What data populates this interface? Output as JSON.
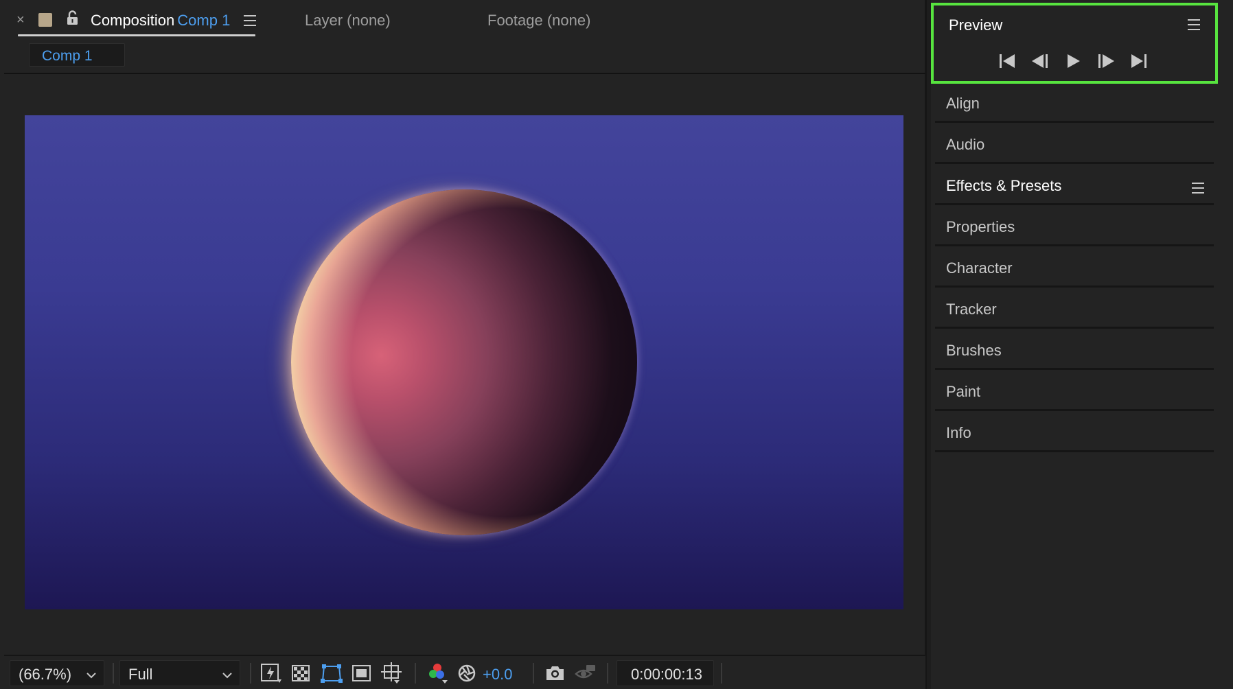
{
  "composition_panel": {
    "close_glyph": "×",
    "title_prefix": "Composition",
    "title_comp": "Comp 1",
    "other_tabs": [
      "Layer (none)",
      "Footage (none)"
    ],
    "subtab": "Comp 1",
    "swatch_color": "#b7a68a",
    "accent_color": "#4d9ff0"
  },
  "viewer_toolbar": {
    "zoom": "(66.7%)",
    "resolution": "Full",
    "exposure": "+0.0",
    "timecode": "0:00:00:13",
    "icons": [
      "fast-previews-icon",
      "transparency-grid-icon",
      "mask-path-visibility-icon",
      "region-of-interest-icon",
      "grid-guides-icon",
      "color-channels-icon",
      "color-management-icon",
      "snapshot-icon",
      "show-snapshot-icon"
    ]
  },
  "right_panels": {
    "preview": {
      "title": "Preview",
      "highlight_color": "#57e43f",
      "controls": [
        "first-frame-icon",
        "previous-frame-icon",
        "play-icon",
        "next-frame-icon",
        "last-frame-icon"
      ]
    },
    "rows": [
      {
        "label": "Align"
      },
      {
        "label": "Audio"
      },
      {
        "label": "Effects & Presets"
      },
      {
        "label": "Properties"
      },
      {
        "label": "Character"
      },
      {
        "label": "Tracker"
      },
      {
        "label": "Brushes"
      },
      {
        "label": "Paint"
      },
      {
        "label": "Info"
      }
    ]
  }
}
